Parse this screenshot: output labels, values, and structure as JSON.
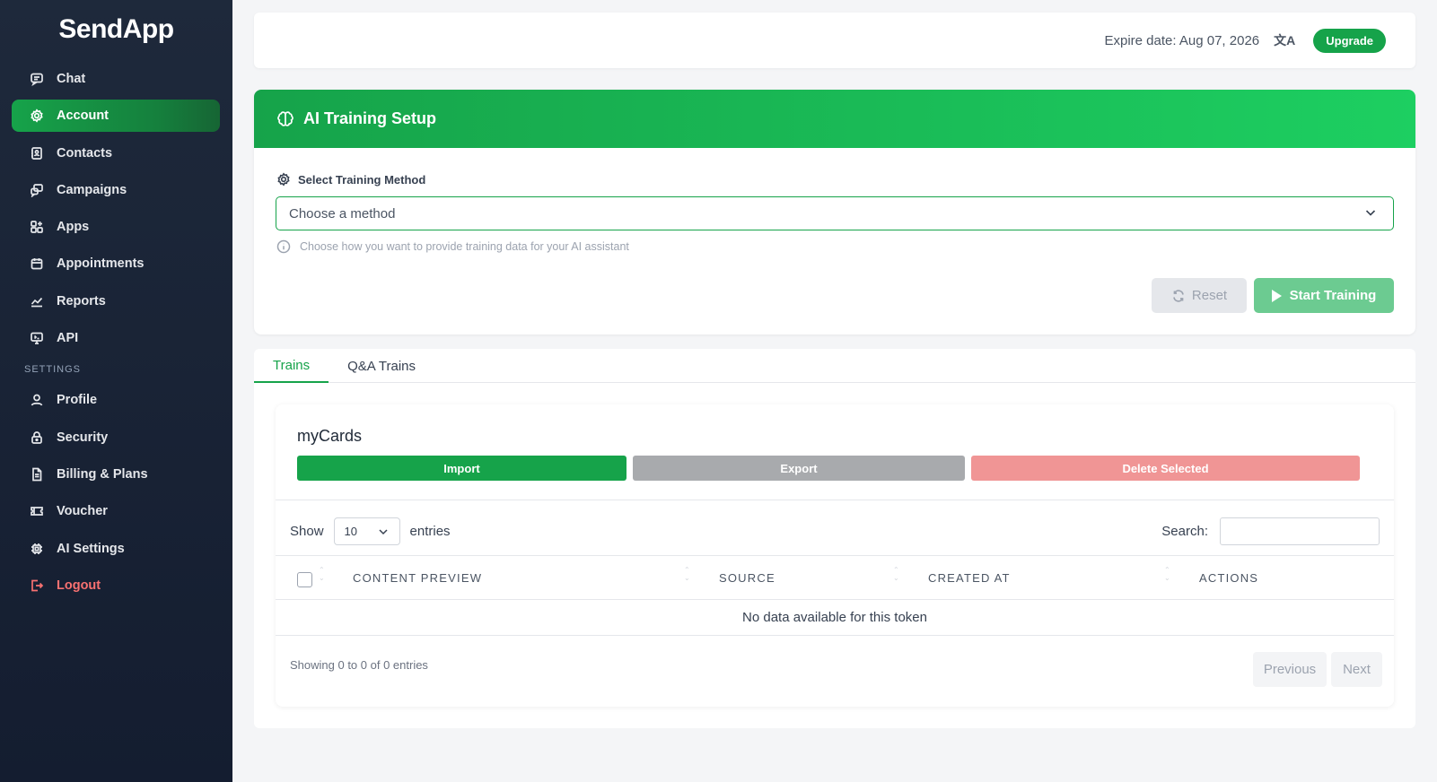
{
  "app": {
    "logo": "SendApp"
  },
  "sidebar": {
    "items": [
      {
        "label": "Chat",
        "icon": "chat-icon"
      },
      {
        "label": "Account",
        "icon": "gear-icon",
        "active": true
      },
      {
        "label": "Contacts",
        "icon": "contacts-icon"
      },
      {
        "label": "Campaigns",
        "icon": "campaigns-icon"
      },
      {
        "label": "Apps",
        "icon": "apps-icon"
      },
      {
        "label": "Appointments",
        "icon": "calendar-icon"
      },
      {
        "label": "Reports",
        "icon": "chart-icon"
      },
      {
        "label": "API",
        "icon": "monitor-icon"
      }
    ],
    "settings_label": "SETTINGS",
    "settings_items": [
      {
        "label": "Profile",
        "icon": "user-icon"
      },
      {
        "label": "Security",
        "icon": "lock-icon"
      },
      {
        "label": "Billing & Plans",
        "icon": "document-icon"
      },
      {
        "label": "Voucher",
        "icon": "ticket-icon"
      },
      {
        "label": "AI Settings",
        "icon": "chip-icon"
      }
    ],
    "logout_label": "Logout"
  },
  "topbar": {
    "expire_text": "Expire date: Aug 07, 2026",
    "upgrade_label": "Upgrade"
  },
  "training": {
    "title": "AI Training Setup",
    "method_label": "Select Training Method",
    "method_placeholder": "Choose a method",
    "help_text": "Choose how you want to provide training data for your AI assistant",
    "reset_label": "Reset",
    "start_label": "Start Training"
  },
  "tabs": [
    {
      "label": "Trains",
      "active": true
    },
    {
      "label": "Q&A Trains"
    }
  ],
  "table_card": {
    "title": "myCards",
    "import_label": "Import",
    "export_label": "Export",
    "delete_label": "Delete Selected",
    "show_label": "Show",
    "entries_value": "10",
    "entries_label": "entries",
    "search_label": "Search:",
    "columns": [
      "CONTENT PREVIEW",
      "SOURCE",
      "CREATED AT",
      "ACTIONS"
    ],
    "empty_text": "No data available for this token",
    "info_text": "Showing 0 to 0 of 0 entries",
    "prev_label": "Previous",
    "next_label": "Next"
  },
  "colors": {
    "accent": "#16a34a",
    "sidebar_bg": "#1e293b",
    "danger": "#f87171"
  }
}
